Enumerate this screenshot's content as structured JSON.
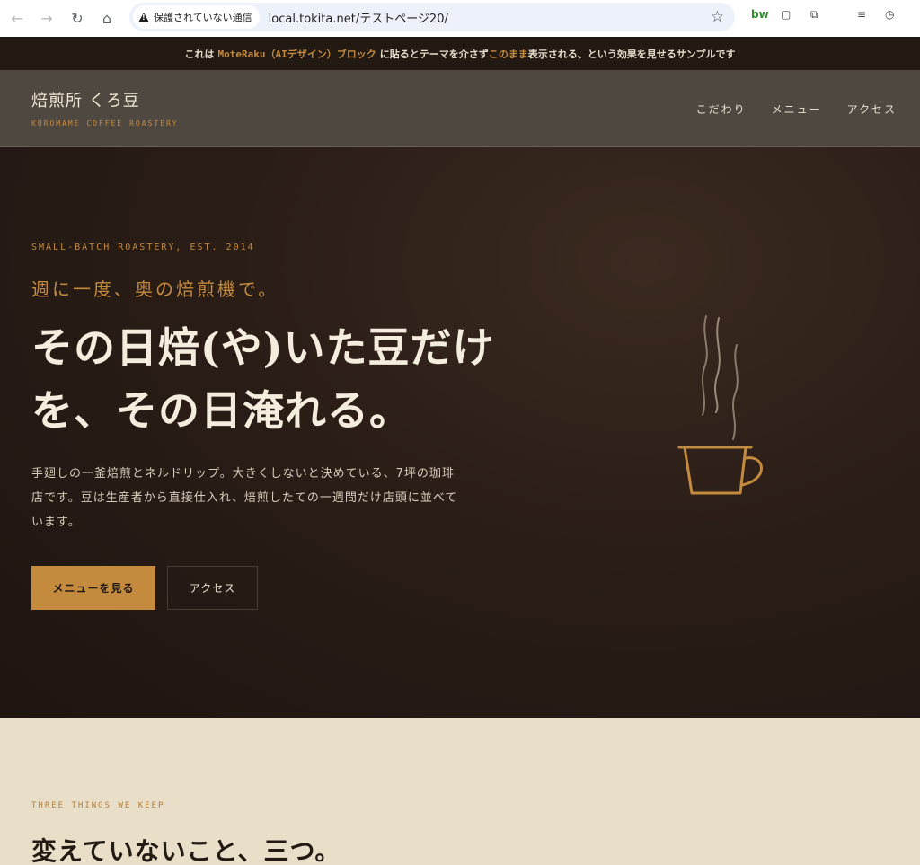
{
  "browser": {
    "security_label": "保護されていない通信",
    "url": "local.tokita.net/テストページ20/"
  },
  "notice": {
    "prefix": "これは",
    "code": "MoteRaku（AIデザイン）ブロック",
    "middle": "に貼るとテーマを介さず",
    "accent": "このまま",
    "suffix": "表示される、という効果を見せるサンプルです"
  },
  "site": {
    "brand": "焙煎所 くろ豆",
    "brand_sub": "KUROMAME COFFEE ROASTERY",
    "nav": [
      "こだわり",
      "メニュー",
      "アクセス"
    ]
  },
  "hero": {
    "eyebrow": "SMALL-BATCH ROASTERY, EST. 2014",
    "lead": "週に一度、奥の焙煎機で。",
    "headline": "その日焙(や)いた豆だけを、その日淹れる。",
    "description": "手廻しの一釜焙煎とネルドリップ。大きくしないと決めている、7坪の珈琲店です。豆は生産者から直接仕入れ、焙煎したての一週間だけ店頭に並べています。",
    "primary_button": "メニューを見る",
    "secondary_button": "アクセス"
  },
  "section": {
    "eyebrow": "THREE THINGS WE KEEP",
    "title": "変えていないこと、三つ。"
  },
  "colors": {
    "accent": "#c48b3e",
    "dark": "#221913",
    "header": "#4f4840",
    "cream": "#e9dfc8"
  }
}
